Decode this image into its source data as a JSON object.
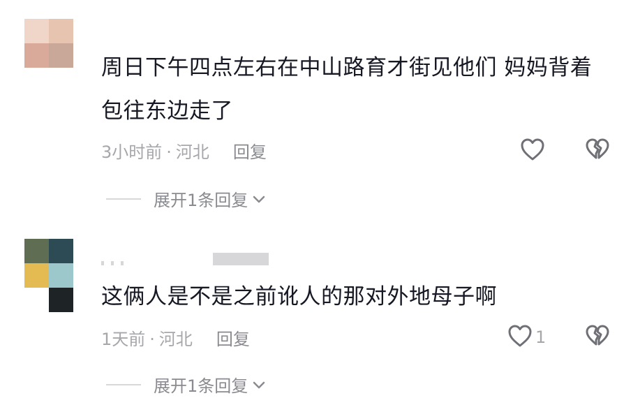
{
  "comments": [
    {
      "content": "周日下午四点左右在中山路育才街见他们 妈妈背着包往东边走了",
      "time": "3小时前",
      "separator": "·",
      "location": "河北",
      "reply_label": "回复",
      "like_count": "",
      "expand_label": "展开1条回复"
    },
    {
      "content": "这俩人是不是之前讹人的那对外地母子啊",
      "time": "1天前",
      "separator": "·",
      "location": "河北",
      "reply_label": "回复",
      "like_count": "1",
      "expand_label": "展开1条回复"
    }
  ],
  "colors": {
    "text": "#161823",
    "meta": "#a6a7ab",
    "icon": "#6f7075"
  },
  "icons": [
    "heart-outline-icon",
    "broken-heart-icon",
    "chevron-down-icon"
  ]
}
